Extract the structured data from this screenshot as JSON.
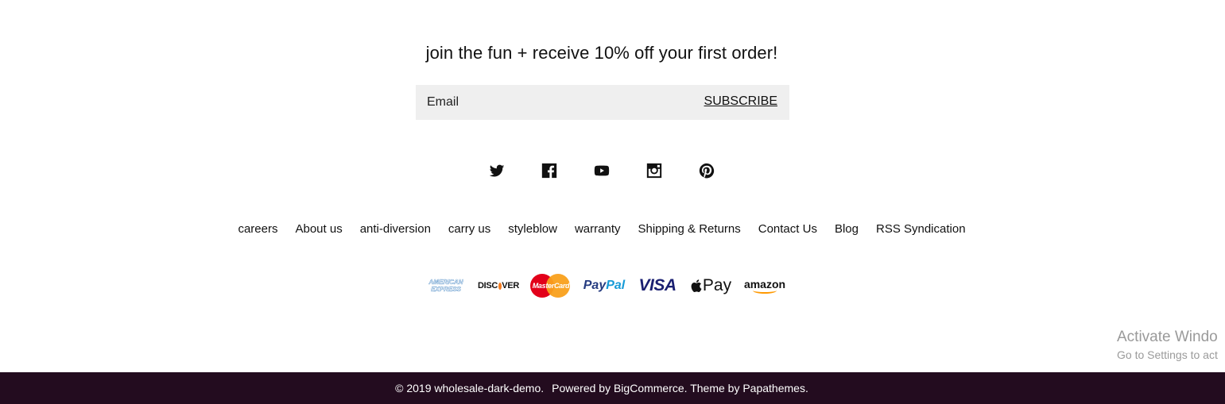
{
  "newsletter": {
    "heading": "join the fun + receive 10% off your first order!",
    "email_placeholder": "Email",
    "subscribe_label": "SUBSCRIBE"
  },
  "social": [
    {
      "name": "twitter-icon"
    },
    {
      "name": "facebook-icon"
    },
    {
      "name": "youtube-icon"
    },
    {
      "name": "instagram-icon"
    },
    {
      "name": "pinterest-icon"
    }
  ],
  "footer_links": [
    "careers",
    "About us",
    "anti-diversion",
    "carry us",
    "styleblow",
    "warranty",
    "Shipping & Returns",
    "Contact Us",
    "Blog",
    "RSS Syndication"
  ],
  "payments": {
    "amex_line1": "AMERICAN",
    "amex_line2": "EXPRESS",
    "discover_a": "DISC",
    "discover_b": "VER",
    "mastercard": "MasterCard",
    "paypal_a": "Pay",
    "paypal_b": "Pal",
    "visa": "VISA",
    "applepay": "Pay",
    "amazon": "amazon"
  },
  "watermark": {
    "line1": "Activate Windo",
    "line2": "Go to Settings to act"
  },
  "bottom_bar": {
    "copyright": "© 2019 wholesale-dark-demo.",
    "powered_prefix": "Powered by ",
    "powered_link": "BigCommerce",
    "theme_prefix": ". Theme by ",
    "theme_link": "Papathemes",
    "theme_suffix": "."
  },
  "colors": {
    "bottom_bar_bg": "#230c1f",
    "input_bg": "#efefef"
  }
}
